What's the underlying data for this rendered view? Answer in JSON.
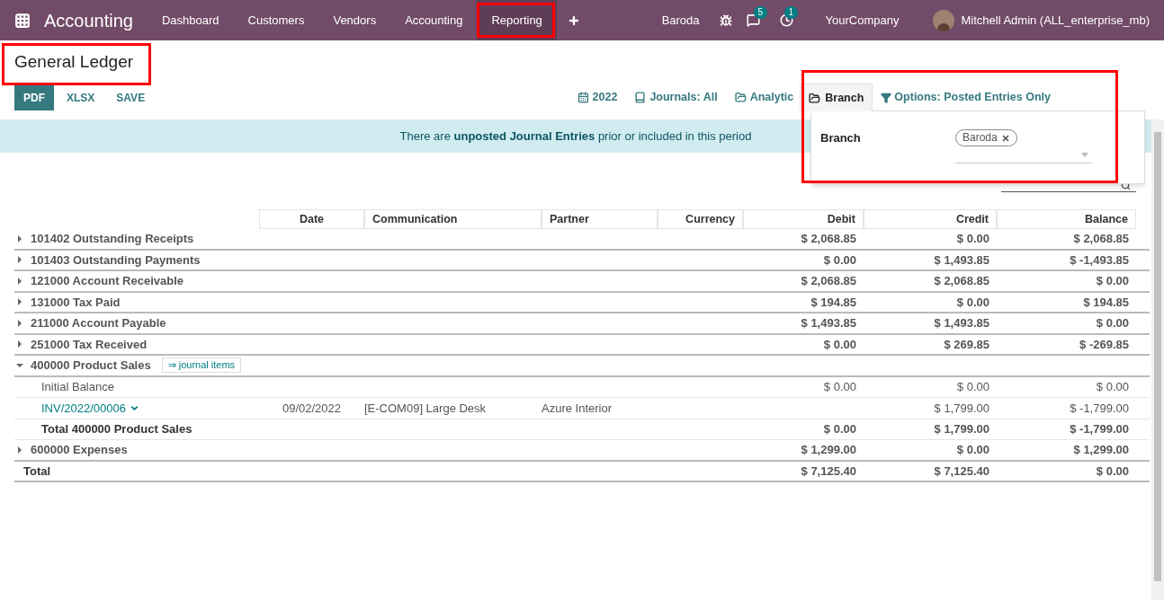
{
  "navbar": {
    "app_name": "Accounting",
    "menu": [
      {
        "label": "Dashboard",
        "selected": false
      },
      {
        "label": "Customers",
        "selected": false
      },
      {
        "label": "Vendors",
        "selected": false
      },
      {
        "label": "Accounting",
        "selected": false
      },
      {
        "label": "Reporting",
        "selected": true
      }
    ],
    "branch": "Baroda",
    "messages_count": "5",
    "activities_count": "1",
    "company": "YourCompany",
    "user": "Mitchell Admin (ALL_enterprise_mb)"
  },
  "title": "General Ledger",
  "actions": [
    {
      "label": "PDF",
      "selected": true
    },
    {
      "label": "XLSX",
      "selected": false
    },
    {
      "label": "SAVE",
      "selected": false
    }
  ],
  "filters": [
    {
      "kind": "calendar",
      "label": "2022"
    },
    {
      "kind": "book",
      "label": "Journals: All"
    },
    {
      "kind": "folder",
      "label": "Analytic"
    }
  ],
  "branch_filter": {
    "label": "Branch",
    "expanded": true,
    "field_label": "Branch",
    "tags": [
      "Baroda"
    ]
  },
  "options_filter": {
    "label": "Options: Posted Entries Only"
  },
  "alert": "There are **unposted Journal Entries** prior or included in this period",
  "table": {
    "columns": [
      "Date",
      "Communication",
      "Partner",
      "Currency",
      "Debit",
      "Credit",
      "Balance"
    ],
    "rows": [
      {
        "kind": "account",
        "name": "101402 Outstanding Receipts",
        "expanded": false,
        "debit": "$ 2,068.85",
        "credit": "$ 0.00",
        "balance": "$ 2,068.85"
      },
      {
        "kind": "account",
        "name": "101403 Outstanding Payments",
        "expanded": false,
        "debit": "$ 0.00",
        "credit": "$ 1,493.85",
        "balance": "$ -1,493.85"
      },
      {
        "kind": "account",
        "name": "121000 Account Receivable",
        "expanded": false,
        "debit": "$ 2,068.85",
        "credit": "$ 2,068.85",
        "balance": "$ 0.00"
      },
      {
        "kind": "account",
        "name": "131000 Tax Paid",
        "expanded": false,
        "debit": "$ 194.85",
        "credit": "$ 0.00",
        "balance": "$ 194.85"
      },
      {
        "kind": "account",
        "name": "211000 Account Payable",
        "expanded": false,
        "debit": "$ 1,493.85",
        "credit": "$ 1,493.85",
        "balance": "$ 0.00"
      },
      {
        "kind": "account",
        "name": "251000 Tax Received",
        "expanded": false,
        "debit": "$ 0.00",
        "credit": "$ 269.85",
        "balance": "$ -269.85"
      },
      {
        "kind": "account",
        "name": "400000 Product Sales",
        "expanded": true,
        "link": "⇒ journal items"
      },
      {
        "kind": "initial",
        "name": "Initial Balance",
        "debit": "$ 0.00",
        "credit": "$ 0.00",
        "balance": "$ 0.00"
      },
      {
        "kind": "move",
        "name": "INV/2022/00006",
        "date": "09/02/2022",
        "communication": "[E-COM09] Large Desk",
        "partner": "Azure Interior",
        "credit": "$ 1,799.00",
        "balance": "$ -1,799.00"
      },
      {
        "kind": "subtotal",
        "name": "Total 400000 Product Sales",
        "debit": "$ 0.00",
        "credit": "$ 1,799.00",
        "balance": "$ -1,799.00"
      },
      {
        "kind": "account",
        "name": "600000 Expenses",
        "expanded": false,
        "debit": "$ 1,299.00",
        "credit": "$ 0.00",
        "balance": "$ 1,299.00"
      },
      {
        "kind": "total",
        "name": "Total",
        "debit": "$ 7,125.40",
        "credit": "$ 7,125.40",
        "balance": "$ 0.00"
      }
    ]
  }
}
